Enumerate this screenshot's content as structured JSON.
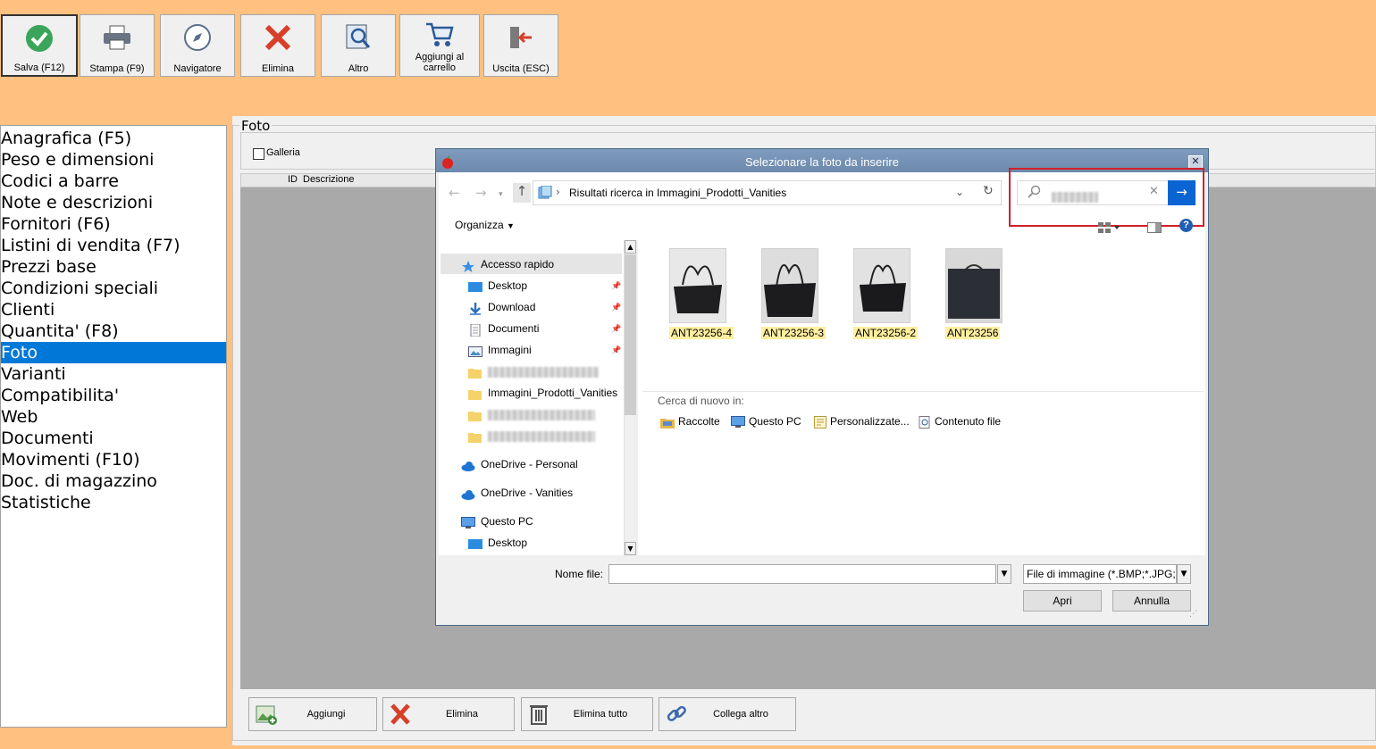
{
  "toolbar": {
    "save": "Salva (F12)",
    "print": "Stampa (F9)",
    "navigator": "Navigatore",
    "delete": "Elimina",
    "other": "Altro",
    "add_cart": "Aggiungi al carrello",
    "exit": "Uscita (ESC)"
  },
  "nav": {
    "items": [
      "Anagrafica (F5)",
      "Peso e dimensioni",
      "Codici a barre",
      "Note e descrizioni",
      "Fornitori (F6)",
      "Listini di vendita (F7)",
      "Prezzi base",
      "Condizioni speciali",
      "Clienti",
      "Quantita' (F8)",
      "Foto",
      "Varianti",
      "Compatibilita'",
      "Web",
      "Documenti",
      "Movimenti (F10)",
      "Doc. di magazzino",
      "Statistiche"
    ],
    "active": "Foto"
  },
  "panel": {
    "title": "Foto",
    "gallery_label": "Galleria",
    "col_id": "ID",
    "col_desc": "Descrizione"
  },
  "bottom": {
    "add": "Aggiungi",
    "delete": "Elimina",
    "delete_all": "Elimina tutto",
    "link_other": "Collega altro"
  },
  "dialog": {
    "title": "Selezionare la foto da inserire",
    "address": "Risultati ricerca in Immagini_Prodotti_Vanities",
    "organize": "Organizza",
    "tree": {
      "quick_access": "Accesso rapido",
      "desktop": "Desktop",
      "download": "Download",
      "documents": "Documenti",
      "images": "Immagini",
      "folder_visible": "Immagini_Prodotti_Vanities",
      "onedrive_personal": "OneDrive - Personal",
      "onedrive_vanities": "OneDrive - Vanities",
      "this_pc": "Questo PC",
      "desktop2": "Desktop"
    },
    "files": [
      "ANT23256-4",
      "ANT23256-3",
      "ANT23256-2",
      "ANT23256"
    ],
    "search_again": "Cerca di nuovo in:",
    "search_locations": [
      "Raccolte",
      "Questo PC",
      "Personalizzate...",
      "Contenuto file"
    ],
    "filename_label": "Nome file:",
    "filename_value": "",
    "filter": "File di immagine (*.BMP;*.JPG;*",
    "open": "Apri",
    "cancel": "Annulla"
  },
  "colors": {
    "background": "#FFC080",
    "selection": "#0078d7",
    "highlight_box": "#d0202a"
  }
}
